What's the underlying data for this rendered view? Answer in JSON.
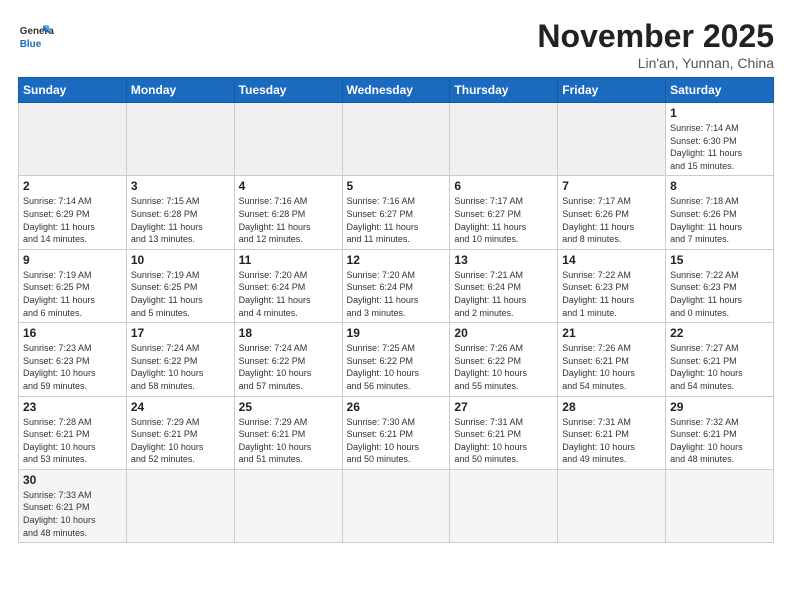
{
  "header": {
    "logo_general": "General",
    "logo_blue": "Blue",
    "month_title": "November 2025",
    "location": "Lin'an, Yunnan, China"
  },
  "weekdays": [
    "Sunday",
    "Monday",
    "Tuesday",
    "Wednesday",
    "Thursday",
    "Friday",
    "Saturday"
  ],
  "days": [
    {
      "date": "",
      "info": ""
    },
    {
      "date": "",
      "info": ""
    },
    {
      "date": "",
      "info": ""
    },
    {
      "date": "",
      "info": ""
    },
    {
      "date": "",
      "info": ""
    },
    {
      "date": "",
      "info": ""
    },
    {
      "date": "1",
      "info": "Sunrise: 7:14 AM\nSunset: 6:30 PM\nDaylight: 11 hours\nand 15 minutes."
    },
    {
      "date": "2",
      "info": "Sunrise: 7:14 AM\nSunset: 6:29 PM\nDaylight: 11 hours\nand 14 minutes."
    },
    {
      "date": "3",
      "info": "Sunrise: 7:15 AM\nSunset: 6:28 PM\nDaylight: 11 hours\nand 13 minutes."
    },
    {
      "date": "4",
      "info": "Sunrise: 7:16 AM\nSunset: 6:28 PM\nDaylight: 11 hours\nand 12 minutes."
    },
    {
      "date": "5",
      "info": "Sunrise: 7:16 AM\nSunset: 6:27 PM\nDaylight: 11 hours\nand 11 minutes."
    },
    {
      "date": "6",
      "info": "Sunrise: 7:17 AM\nSunset: 6:27 PM\nDaylight: 11 hours\nand 10 minutes."
    },
    {
      "date": "7",
      "info": "Sunrise: 7:17 AM\nSunset: 6:26 PM\nDaylight: 11 hours\nand 8 minutes."
    },
    {
      "date": "8",
      "info": "Sunrise: 7:18 AM\nSunset: 6:26 PM\nDaylight: 11 hours\nand 7 minutes."
    },
    {
      "date": "9",
      "info": "Sunrise: 7:19 AM\nSunset: 6:25 PM\nDaylight: 11 hours\nand 6 minutes."
    },
    {
      "date": "10",
      "info": "Sunrise: 7:19 AM\nSunset: 6:25 PM\nDaylight: 11 hours\nand 5 minutes."
    },
    {
      "date": "11",
      "info": "Sunrise: 7:20 AM\nSunset: 6:24 PM\nDaylight: 11 hours\nand 4 minutes."
    },
    {
      "date": "12",
      "info": "Sunrise: 7:20 AM\nSunset: 6:24 PM\nDaylight: 11 hours\nand 3 minutes."
    },
    {
      "date": "13",
      "info": "Sunrise: 7:21 AM\nSunset: 6:24 PM\nDaylight: 11 hours\nand 2 minutes."
    },
    {
      "date": "14",
      "info": "Sunrise: 7:22 AM\nSunset: 6:23 PM\nDaylight: 11 hours\nand 1 minute."
    },
    {
      "date": "15",
      "info": "Sunrise: 7:22 AM\nSunset: 6:23 PM\nDaylight: 11 hours\nand 0 minutes."
    },
    {
      "date": "16",
      "info": "Sunrise: 7:23 AM\nSunset: 6:23 PM\nDaylight: 10 hours\nand 59 minutes."
    },
    {
      "date": "17",
      "info": "Sunrise: 7:24 AM\nSunset: 6:22 PM\nDaylight: 10 hours\nand 58 minutes."
    },
    {
      "date": "18",
      "info": "Sunrise: 7:24 AM\nSunset: 6:22 PM\nDaylight: 10 hours\nand 57 minutes."
    },
    {
      "date": "19",
      "info": "Sunrise: 7:25 AM\nSunset: 6:22 PM\nDaylight: 10 hours\nand 56 minutes."
    },
    {
      "date": "20",
      "info": "Sunrise: 7:26 AM\nSunset: 6:22 PM\nDaylight: 10 hours\nand 55 minutes."
    },
    {
      "date": "21",
      "info": "Sunrise: 7:26 AM\nSunset: 6:21 PM\nDaylight: 10 hours\nand 54 minutes."
    },
    {
      "date": "22",
      "info": "Sunrise: 7:27 AM\nSunset: 6:21 PM\nDaylight: 10 hours\nand 54 minutes."
    },
    {
      "date": "23",
      "info": "Sunrise: 7:28 AM\nSunset: 6:21 PM\nDaylight: 10 hours\nand 53 minutes."
    },
    {
      "date": "24",
      "info": "Sunrise: 7:29 AM\nSunset: 6:21 PM\nDaylight: 10 hours\nand 52 minutes."
    },
    {
      "date": "25",
      "info": "Sunrise: 7:29 AM\nSunset: 6:21 PM\nDaylight: 10 hours\nand 51 minutes."
    },
    {
      "date": "26",
      "info": "Sunrise: 7:30 AM\nSunset: 6:21 PM\nDaylight: 10 hours\nand 50 minutes."
    },
    {
      "date": "27",
      "info": "Sunrise: 7:31 AM\nSunset: 6:21 PM\nDaylight: 10 hours\nand 50 minutes."
    },
    {
      "date": "28",
      "info": "Sunrise: 7:31 AM\nSunset: 6:21 PM\nDaylight: 10 hours\nand 49 minutes."
    },
    {
      "date": "29",
      "info": "Sunrise: 7:32 AM\nSunset: 6:21 PM\nDaylight: 10 hours\nand 48 minutes."
    },
    {
      "date": "30",
      "info": "Sunrise: 7:33 AM\nSunset: 6:21 PM\nDaylight: 10 hours\nand 48 minutes."
    }
  ]
}
